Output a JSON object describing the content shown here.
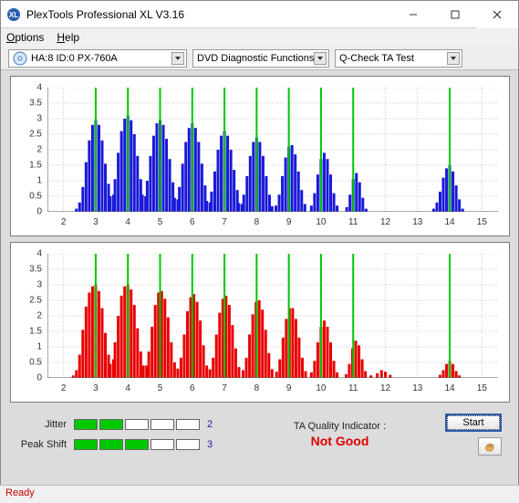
{
  "window": {
    "title": "PlexTools Professional XL V3.16"
  },
  "menu": {
    "options": "Options",
    "help": "Help"
  },
  "toolbar": {
    "drive": "HA:8 ID:0  PX-760A",
    "diag": "DVD Diagnostic Functions",
    "test": "Q-Check TA Test"
  },
  "chart_data": [
    {
      "type": "bar",
      "color": "#1919d8",
      "ylim": [
        0,
        4
      ],
      "xlim": [
        1.5,
        15.5
      ],
      "yticks": [
        0,
        0.5,
        1,
        1.5,
        2,
        2.5,
        3,
        3.5,
        4
      ],
      "xticks": [
        2,
        3,
        4,
        5,
        6,
        7,
        8,
        9,
        10,
        11,
        12,
        13,
        14,
        15
      ],
      "peak_lines": [
        3,
        4,
        5,
        6,
        7,
        8,
        9,
        10,
        11,
        14
      ],
      "series": [
        {
          "x": 2.4,
          "y": 0.1
        },
        {
          "x": 2.5,
          "y": 0.3
        },
        {
          "x": 2.6,
          "y": 0.8
        },
        {
          "x": 2.7,
          "y": 1.6
        },
        {
          "x": 2.8,
          "y": 2.3
        },
        {
          "x": 2.9,
          "y": 2.8
        },
        {
          "x": 3.0,
          "y": 2.95
        },
        {
          "x": 3.1,
          "y": 2.8
        },
        {
          "x": 3.2,
          "y": 2.3
        },
        {
          "x": 3.3,
          "y": 1.55
        },
        {
          "x": 3.4,
          "y": 0.9
        },
        {
          "x": 3.45,
          "y": 0.5
        },
        {
          "x": 3.55,
          "y": 0.55
        },
        {
          "x": 3.6,
          "y": 1.05
        },
        {
          "x": 3.7,
          "y": 1.9
        },
        {
          "x": 3.8,
          "y": 2.6
        },
        {
          "x": 3.9,
          "y": 3.0
        },
        {
          "x": 4.0,
          "y": 3.1
        },
        {
          "x": 4.1,
          "y": 2.95
        },
        {
          "x": 4.2,
          "y": 2.5
        },
        {
          "x": 4.3,
          "y": 1.8
        },
        {
          "x": 4.4,
          "y": 1.05
        },
        {
          "x": 4.45,
          "y": 0.55
        },
        {
          "x": 4.55,
          "y": 0.5
        },
        {
          "x": 4.6,
          "y": 1.0
        },
        {
          "x": 4.7,
          "y": 1.8
        },
        {
          "x": 4.8,
          "y": 2.45
        },
        {
          "x": 4.9,
          "y": 2.85
        },
        {
          "x": 5.0,
          "y": 2.95
        },
        {
          "x": 5.1,
          "y": 2.8
        },
        {
          "x": 5.2,
          "y": 2.35
        },
        {
          "x": 5.3,
          "y": 1.7
        },
        {
          "x": 5.4,
          "y": 0.95
        },
        {
          "x": 5.45,
          "y": 0.45
        },
        {
          "x": 5.55,
          "y": 0.4
        },
        {
          "x": 5.6,
          "y": 0.8
        },
        {
          "x": 5.7,
          "y": 1.55
        },
        {
          "x": 5.8,
          "y": 2.25
        },
        {
          "x": 5.9,
          "y": 2.7
        },
        {
          "x": 6.0,
          "y": 2.85
        },
        {
          "x": 6.1,
          "y": 2.7
        },
        {
          "x": 6.2,
          "y": 2.25
        },
        {
          "x": 6.3,
          "y": 1.55
        },
        {
          "x": 6.4,
          "y": 0.85
        },
        {
          "x": 6.45,
          "y": 0.35
        },
        {
          "x": 6.55,
          "y": 0.3
        },
        {
          "x": 6.6,
          "y": 0.65
        },
        {
          "x": 6.7,
          "y": 1.3
        },
        {
          "x": 6.8,
          "y": 2.0
        },
        {
          "x": 6.9,
          "y": 2.45
        },
        {
          "x": 7.0,
          "y": 2.6
        },
        {
          "x": 7.1,
          "y": 2.45
        },
        {
          "x": 7.2,
          "y": 2.0
        },
        {
          "x": 7.3,
          "y": 1.35
        },
        {
          "x": 7.4,
          "y": 0.7
        },
        {
          "x": 7.45,
          "y": 0.28
        },
        {
          "x": 7.55,
          "y": 0.25
        },
        {
          "x": 7.6,
          "y": 0.55
        },
        {
          "x": 7.7,
          "y": 1.15
        },
        {
          "x": 7.8,
          "y": 1.8
        },
        {
          "x": 7.9,
          "y": 2.25
        },
        {
          "x": 8.0,
          "y": 2.4
        },
        {
          "x": 8.1,
          "y": 2.25
        },
        {
          "x": 8.2,
          "y": 1.8
        },
        {
          "x": 8.3,
          "y": 1.15
        },
        {
          "x": 8.4,
          "y": 0.55
        },
        {
          "x": 8.48,
          "y": 0.18
        },
        {
          "x": 8.6,
          "y": 0.2
        },
        {
          "x": 8.7,
          "y": 0.55
        },
        {
          "x": 8.8,
          "y": 1.15
        },
        {
          "x": 8.9,
          "y": 1.75
        },
        {
          "x": 9.0,
          "y": 2.1
        },
        {
          "x": 9.1,
          "y": 2.15
        },
        {
          "x": 9.2,
          "y": 1.85
        },
        {
          "x": 9.3,
          "y": 1.3
        },
        {
          "x": 9.4,
          "y": 0.7
        },
        {
          "x": 9.5,
          "y": 0.25
        },
        {
          "x": 9.7,
          "y": 0.2
        },
        {
          "x": 9.8,
          "y": 0.6
        },
        {
          "x": 9.9,
          "y": 1.2
        },
        {
          "x": 10.0,
          "y": 1.7
        },
        {
          "x": 10.1,
          "y": 1.9
        },
        {
          "x": 10.2,
          "y": 1.7
        },
        {
          "x": 10.3,
          "y": 1.2
        },
        {
          "x": 10.4,
          "y": 0.6
        },
        {
          "x": 10.5,
          "y": 0.2
        },
        {
          "x": 10.8,
          "y": 0.15
        },
        {
          "x": 10.9,
          "y": 0.55
        },
        {
          "x": 11.0,
          "y": 1.05
        },
        {
          "x": 11.1,
          "y": 1.25
        },
        {
          "x": 11.2,
          "y": 0.95
        },
        {
          "x": 11.3,
          "y": 0.45
        },
        {
          "x": 11.4,
          "y": 0.1
        },
        {
          "x": 13.5,
          "y": 0.1
        },
        {
          "x": 13.6,
          "y": 0.3
        },
        {
          "x": 13.7,
          "y": 0.65
        },
        {
          "x": 13.8,
          "y": 1.1
        },
        {
          "x": 13.9,
          "y": 1.4
        },
        {
          "x": 14.0,
          "y": 1.5
        },
        {
          "x": 14.1,
          "y": 1.3
        },
        {
          "x": 14.2,
          "y": 0.85
        },
        {
          "x": 14.3,
          "y": 0.4
        },
        {
          "x": 14.4,
          "y": 0.1
        }
      ]
    },
    {
      "type": "bar",
      "color": "#e80000",
      "ylim": [
        0,
        4
      ],
      "xlim": [
        1.5,
        15.5
      ],
      "yticks": [
        0,
        0.5,
        1,
        1.5,
        2,
        2.5,
        3,
        3.5,
        4
      ],
      "xticks": [
        2,
        3,
        4,
        5,
        6,
        7,
        8,
        9,
        10,
        11,
        12,
        13,
        14,
        15
      ],
      "peak_lines": [
        3,
        4,
        5,
        6,
        7,
        8,
        9,
        10,
        11,
        14
      ],
      "series": [
        {
          "x": 2.3,
          "y": 0.08
        },
        {
          "x": 2.4,
          "y": 0.25
        },
        {
          "x": 2.5,
          "y": 0.75
        },
        {
          "x": 2.6,
          "y": 1.55
        },
        {
          "x": 2.7,
          "y": 2.3
        },
        {
          "x": 2.8,
          "y": 2.75
        },
        {
          "x": 2.9,
          "y": 2.95
        },
        {
          "x": 3.0,
          "y": 3.0
        },
        {
          "x": 3.1,
          "y": 2.8
        },
        {
          "x": 3.2,
          "y": 2.25
        },
        {
          "x": 3.3,
          "y": 1.45
        },
        {
          "x": 3.4,
          "y": 0.75
        },
        {
          "x": 3.45,
          "y": 0.45
        },
        {
          "x": 3.55,
          "y": 0.6
        },
        {
          "x": 3.6,
          "y": 1.15
        },
        {
          "x": 3.7,
          "y": 2.0
        },
        {
          "x": 3.8,
          "y": 2.65
        },
        {
          "x": 3.9,
          "y": 2.95
        },
        {
          "x": 4.0,
          "y": 3.0
        },
        {
          "x": 4.1,
          "y": 2.85
        },
        {
          "x": 4.2,
          "y": 2.35
        },
        {
          "x": 4.3,
          "y": 1.6
        },
        {
          "x": 4.4,
          "y": 0.85
        },
        {
          "x": 4.48,
          "y": 0.4
        },
        {
          "x": 4.58,
          "y": 0.4
        },
        {
          "x": 4.65,
          "y": 0.85
        },
        {
          "x": 4.75,
          "y": 1.65
        },
        {
          "x": 4.85,
          "y": 2.35
        },
        {
          "x": 4.95,
          "y": 2.75
        },
        {
          "x": 5.05,
          "y": 2.8
        },
        {
          "x": 5.15,
          "y": 2.55
        },
        {
          "x": 5.25,
          "y": 1.95
        },
        {
          "x": 5.35,
          "y": 1.15
        },
        {
          "x": 5.45,
          "y": 0.5
        },
        {
          "x": 5.55,
          "y": 0.3
        },
        {
          "x": 5.65,
          "y": 0.65
        },
        {
          "x": 5.75,
          "y": 1.4
        },
        {
          "x": 5.85,
          "y": 2.15
        },
        {
          "x": 5.95,
          "y": 2.6
        },
        {
          "x": 6.05,
          "y": 2.7
        },
        {
          "x": 6.15,
          "y": 2.45
        },
        {
          "x": 6.25,
          "y": 1.85
        },
        {
          "x": 6.35,
          "y": 1.05
        },
        {
          "x": 6.45,
          "y": 0.4
        },
        {
          "x": 6.55,
          "y": 0.28
        },
        {
          "x": 6.65,
          "y": 0.65
        },
        {
          "x": 6.75,
          "y": 1.4
        },
        {
          "x": 6.85,
          "y": 2.1
        },
        {
          "x": 6.95,
          "y": 2.55
        },
        {
          "x": 7.05,
          "y": 2.65
        },
        {
          "x": 7.15,
          "y": 2.35
        },
        {
          "x": 7.25,
          "y": 1.7
        },
        {
          "x": 7.35,
          "y": 0.95
        },
        {
          "x": 7.45,
          "y": 0.35
        },
        {
          "x": 7.58,
          "y": 0.25
        },
        {
          "x": 7.68,
          "y": 0.65
        },
        {
          "x": 7.78,
          "y": 1.4
        },
        {
          "x": 7.88,
          "y": 2.05
        },
        {
          "x": 7.98,
          "y": 2.45
        },
        {
          "x": 8.08,
          "y": 2.5
        },
        {
          "x": 8.18,
          "y": 2.2
        },
        {
          "x": 8.28,
          "y": 1.55
        },
        {
          "x": 8.38,
          "y": 0.8
        },
        {
          "x": 8.48,
          "y": 0.28
        },
        {
          "x": 8.62,
          "y": 0.2
        },
        {
          "x": 8.72,
          "y": 0.6
        },
        {
          "x": 8.82,
          "y": 1.3
        },
        {
          "x": 8.92,
          "y": 1.9
        },
        {
          "x": 9.02,
          "y": 2.25
        },
        {
          "x": 9.12,
          "y": 2.25
        },
        {
          "x": 9.22,
          "y": 1.9
        },
        {
          "x": 9.32,
          "y": 1.3
        },
        {
          "x": 9.42,
          "y": 0.65
        },
        {
          "x": 9.52,
          "y": 0.22
        },
        {
          "x": 9.7,
          "y": 0.18
        },
        {
          "x": 9.8,
          "y": 0.55
        },
        {
          "x": 9.9,
          "y": 1.15
        },
        {
          "x": 10.0,
          "y": 1.65
        },
        {
          "x": 10.1,
          "y": 1.85
        },
        {
          "x": 10.2,
          "y": 1.65
        },
        {
          "x": 10.3,
          "y": 1.15
        },
        {
          "x": 10.4,
          "y": 0.55
        },
        {
          "x": 10.5,
          "y": 0.18
        },
        {
          "x": 10.78,
          "y": 0.12
        },
        {
          "x": 10.88,
          "y": 0.45
        },
        {
          "x": 10.98,
          "y": 0.95
        },
        {
          "x": 11.08,
          "y": 1.2
        },
        {
          "x": 11.18,
          "y": 1.05
        },
        {
          "x": 11.28,
          "y": 0.6
        },
        {
          "x": 11.38,
          "y": 0.22
        },
        {
          "x": 11.55,
          "y": 0.08
        },
        {
          "x": 11.75,
          "y": 0.15
        },
        {
          "x": 11.88,
          "y": 0.25
        },
        {
          "x": 12.0,
          "y": 0.2
        },
        {
          "x": 12.15,
          "y": 0.1
        },
        {
          "x": 13.7,
          "y": 0.1
        },
        {
          "x": 13.8,
          "y": 0.25
        },
        {
          "x": 13.9,
          "y": 0.45
        },
        {
          "x": 14.0,
          "y": 0.55
        },
        {
          "x": 14.1,
          "y": 0.45
        },
        {
          "x": 14.2,
          "y": 0.22
        },
        {
          "x": 14.3,
          "y": 0.08
        }
      ]
    }
  ],
  "quality": {
    "jitter_label": "Jitter",
    "jitter_value": "2",
    "jitter_segments": 2,
    "peakshift_label": "Peak Shift",
    "peakshift_value": "3",
    "peakshift_segments": 3,
    "segment_total": 5,
    "ta_label": "TA Quality Indicator :",
    "ta_value": "Not Good"
  },
  "buttons": {
    "start": "Start"
  },
  "status": {
    "text": "Ready"
  }
}
